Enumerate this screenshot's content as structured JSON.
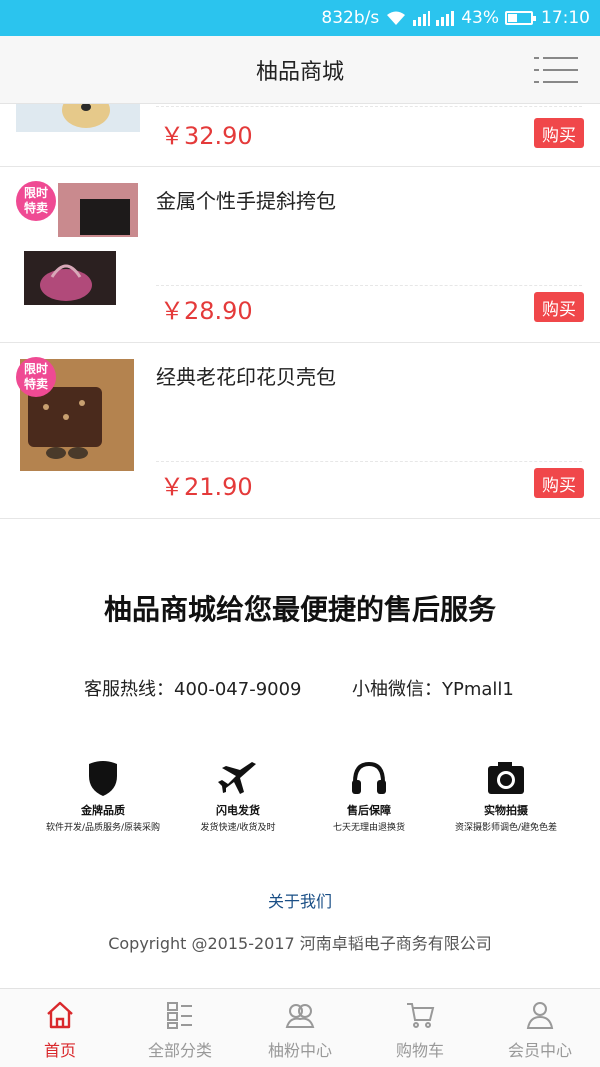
{
  "status_bar": {
    "speed": "832b/s",
    "battery": "43%",
    "time": "17:10",
    "battery_level": 0.43
  },
  "header": {
    "title": "柚品商城",
    "menu_icon": "menu-icon"
  },
  "products": [
    {
      "name": "",
      "price": "￥32.90",
      "buy_label": "购买"
    },
    {
      "name": "金属个性手提斜挎包",
      "price": "￥28.90",
      "buy_label": "购买",
      "badge": [
        "限时",
        "特卖"
      ]
    },
    {
      "name": "经典老花印花贝壳包",
      "price": "￥21.90",
      "buy_label": "购买",
      "badge": [
        "限时",
        "特卖"
      ]
    }
  ],
  "service": {
    "title": "柚品商城给您最便捷的售后服务",
    "hotline": "客服热线：400-047-9009",
    "wechat": "小柚微信：YPmall1",
    "features": [
      {
        "name": "金牌品质",
        "desc": "软件开发/品质服务/原装采购",
        "icon": "shield-icon"
      },
      {
        "name": "闪电发货",
        "desc": "发货快速/收货及时",
        "icon": "airplane-icon"
      },
      {
        "name": "售后保障",
        "desc": "七天无理由退换货",
        "icon": "headphones-icon"
      },
      {
        "name": "实物拍摄",
        "desc": "资深摄影师调色/避免色差",
        "icon": "camera-icon"
      }
    ],
    "about": "关于我们",
    "copyright": "Copyright @2015-2017 河南卓韬电子商务有限公司"
  },
  "bottom_nav": [
    {
      "label": "首页",
      "icon": "home-icon",
      "active": true
    },
    {
      "label": "全部分类",
      "icon": "category-icon",
      "active": false
    },
    {
      "label": "柚粉中心",
      "icon": "community-icon",
      "active": false
    },
    {
      "label": "购物车",
      "icon": "cart-icon",
      "active": false
    },
    {
      "label": "会员中心",
      "icon": "user-icon",
      "active": false
    }
  ],
  "colors": {
    "status_bar": "#2bc4ee",
    "price": "#e43a3a",
    "buy_button": "#f0474a",
    "badge": "#ef4a93",
    "nav_active": "#d9282c"
  }
}
